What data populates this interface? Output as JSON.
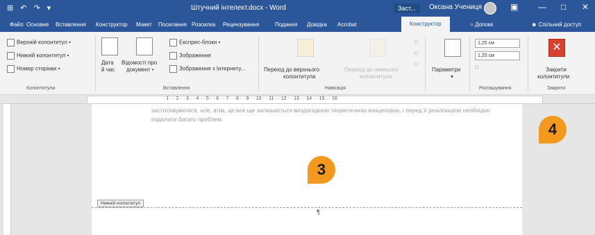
{
  "titlebar": {
    "quick_access": [
      "⊞",
      "↶",
      "↷",
      "▾"
    ],
    "document_title": "Штучний інтелект.docx - Word",
    "context_label": "Заст...",
    "user_name": "Оксана Учениця",
    "window_controls": [
      "▣",
      "—",
      "□",
      "✕"
    ]
  },
  "tabs": [
    "Файл",
    "Основне",
    "Вставлення",
    "Конструктор",
    "Макет",
    "Посилання",
    "Розсилка",
    "Рецензування",
    "Подання",
    "Довідка",
    "Acrobat"
  ],
  "active_tab": "Конструктор",
  "help_tab": "Допомі",
  "share_tab": "Спільний доступ",
  "ribbon": {
    "header_footer": {
      "items": [
        "Верхній колонтитул •",
        "Нижній колонтитул •",
        "Номер сторінки •"
      ],
      "label": "Колонтитули"
    },
    "insert": {
      "date_line1": "Дата",
      "date_line2": "й час",
      "docinfo_line1": "Відомості про",
      "docinfo_line2": "документ •",
      "quick_parts": "Експрес-блоки •",
      "pictures": "Зображення",
      "online_pictures": "Зображення з Інтернету...",
      "label": "Вставлення"
    },
    "navigation": {
      "goto_header_line1": "Перехід до верхнього",
      "goto_header_line2": "колонтитула",
      "goto_footer_line1": "Перехід до нижнього",
      "goto_footer_line2": "колонтитула",
      "label": "Навігація"
    },
    "options": {
      "label": "Параметри"
    },
    "position": {
      "header_distance": "1,25 см",
      "footer_distance": "1,25 см",
      "label": "Розташування"
    },
    "close": {
      "close_icon_glyph": "✕",
      "btn_line1": "Закрити",
      "btn_line2": "колонтитули",
      "label": "Закрити"
    }
  },
  "ruler": {
    "numbers": "· 1 · · 2 · · 3 · · 4 · · 5 · · 6 · · 7 · · 8 · · 9 · · 10 · · 11 · · 12 · · 13 · · 14 · · 15 · · 16"
  },
  "document": {
    "body_text": "застосовуватися, але, втім, це все ще залишається виздогадною теоретичною концепцією, і перед її реалізацією необхідно подолати багато проблем.",
    "footer_label": "Нижній колонтитул",
    "cursor_mark": "¶"
  },
  "callouts": {
    "first": "3",
    "second": "4"
  },
  "colors": {
    "word_blue": "#2b579a",
    "callout_orange": "#f39a1e",
    "close_red": "#d9412f"
  }
}
